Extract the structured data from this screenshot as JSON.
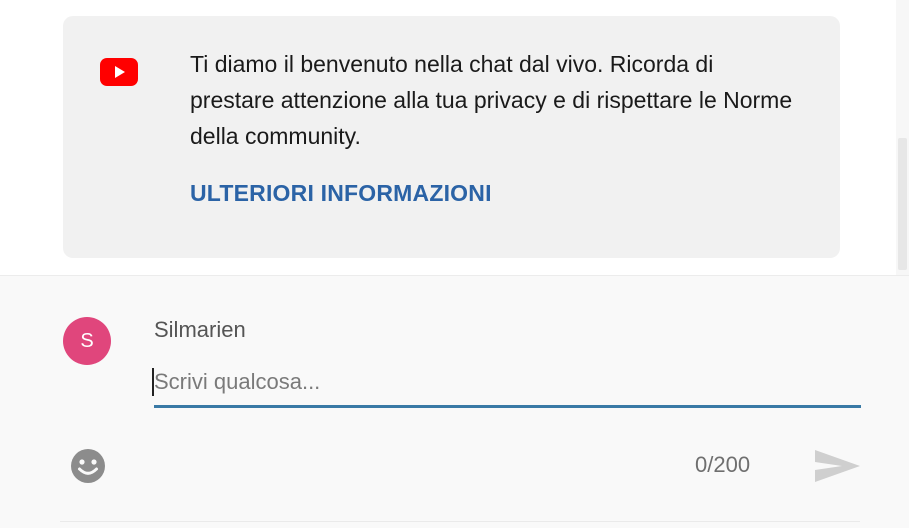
{
  "welcome": {
    "icon": "youtube-logo-icon",
    "message": "Ti diamo il benvenuto nella chat dal vivo. Ricorda di prestare attenzione alla tua privacy e di rispettare le Norme della community.",
    "learn_more_label": "ULTERIORI INFORMAZIONI"
  },
  "composer": {
    "avatar_initial": "S",
    "author_name": "Silmarien",
    "input_value": "",
    "input_placeholder": "Scrivi qualcosa...",
    "char_counter": "0/200",
    "emoji_icon": "smiley-icon",
    "send_icon": "send-arrow-icon"
  },
  "colors": {
    "youtube_red": "#ff0000",
    "link_blue": "#2b63a6",
    "avatar_pink": "#e0467c",
    "input_underline": "#3a7aa6",
    "card_background": "#f1f1f1"
  }
}
